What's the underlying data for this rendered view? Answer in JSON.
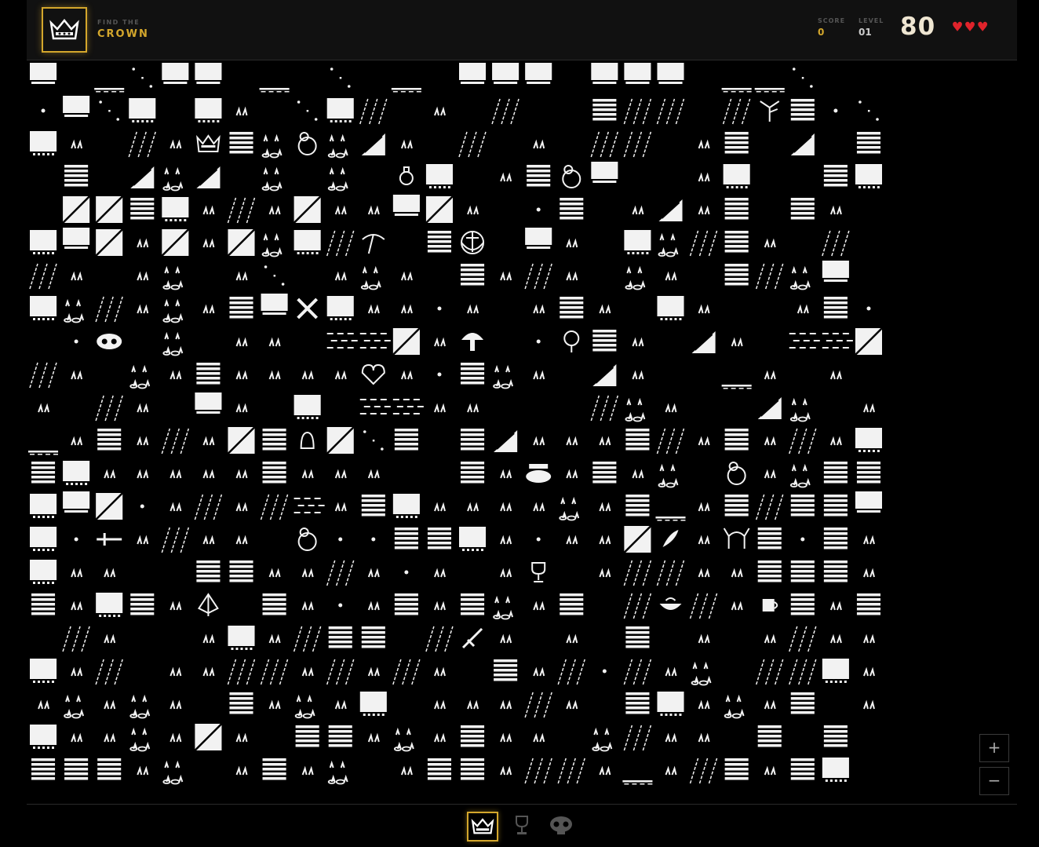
{
  "header": {
    "subtitle": "FIND THE",
    "title": "CROWN",
    "logo_icon": "crown-icon",
    "score_label": "SCORE",
    "score_value": "0",
    "level_label": "LEVEL",
    "level_value": "01",
    "counter": "80",
    "hearts": 3,
    "colors": {
      "accent": "#d4a72c",
      "heart": "#e0232b",
      "counter": "#efe6d2"
    }
  },
  "board": {
    "cols": 26,
    "rows": 22,
    "tiles": [
      "F.wbFF.w.b.w.FFF.FFF.wwb..F..",
      "cFbB.Bp.bBG.p.G..SGG.G.Ssb",
      "Bp.Gp.SgGgRp.G.p.GG.pS.R.S",
      ".S.RgR.g.g.oB.pSpF..pB..SB",
      ".WWSBpGpWppFWp.VS.pRpS.Sp.",
      "BFWpWpWgBGW.SR.Fp.BgGSp.G.",
      "Gp.pg.pb.pgp.SpGp.gp.SGgF.",
      "BgGpgpSF.Bppsp.pSp.Bp..pSP",
      ".kp.g.pp.DDWpB.ogSp.Rp.DDW",
      "Gp.gpSppppppsSgp.Rp..wp.p.",
      "p.Gp.Fp.B.DDpp...Ggp..Rg.p",
      "wpSpGpWSgWbS.SRpppSGpSpGpB",
      "SBpppppSppp..SpppSpg.SpgSS",
      "BFWlpGpGDpSBppppgpSwpSGSSF",
      "BlRpGpp.ghhSSBphppWgp.SfSp",
      "Bpp..SSppGpmp.p..pGGppSSSp",
      "SpBSp..SpspSpSgpS.GpGp.SpS",
      ".Gp..pBpGSS.GSp.p.S.p.pGpp",
      "BpG.ppGGpGpGp.SpGhGpg.GGBp",
      "pgpgp.SpgpB.pppGp.SBpgpS.p",
      "BppgpWp.SSpgpSpp.gGpp.S.S.",
      "SSSpg.pSpg.pSSpGGpwpGSpSB."
    ],
    "items": [
      {
        "name": "crown-icon",
        "col": 5,
        "row": 2
      },
      {
        "name": "ring-icon",
        "col": 8,
        "row": 2
      },
      {
        "name": "ring-icon",
        "col": 16,
        "row": 3
      },
      {
        "name": "potion-icon",
        "col": 11,
        "row": 3
      },
      {
        "name": "anchor-icon",
        "col": 13,
        "row": 5
      },
      {
        "name": "pickaxe-icon",
        "col": 10,
        "row": 5
      },
      {
        "name": "crossbones-icon",
        "col": 8,
        "row": 7
      },
      {
        "name": "skull-icon",
        "col": 2,
        "row": 8
      },
      {
        "name": "mushroom-icon",
        "col": 13,
        "row": 8
      },
      {
        "name": "heart-icon",
        "col": 10,
        "row": 9
      },
      {
        "name": "shield-icon",
        "col": 16,
        "row": 8
      },
      {
        "name": "bell-icon",
        "col": 8,
        "row": 11
      },
      {
        "name": "cauldron-icon",
        "col": 15,
        "row": 12
      },
      {
        "name": "ring-icon",
        "col": 21,
        "row": 12
      },
      {
        "name": "sword-icon",
        "col": 2,
        "row": 14
      },
      {
        "name": "ring-icon",
        "col": 8,
        "row": 14
      },
      {
        "name": "feather-icon",
        "col": 19,
        "row": 14
      },
      {
        "name": "horned-helmet-icon",
        "col": 21,
        "row": 14
      },
      {
        "name": "chalice-icon",
        "col": 15,
        "row": 15
      },
      {
        "name": "leaf-icon",
        "col": 5,
        "row": 16
      },
      {
        "name": "bowl-icon",
        "col": 19,
        "row": 16
      },
      {
        "name": "mug-icon",
        "col": 22,
        "row": 16
      },
      {
        "name": "dagger-icon",
        "col": 13,
        "row": 17
      },
      {
        "name": "tree-icon",
        "col": 22,
        "row": 1
      }
    ]
  },
  "zoom": {
    "in_label": "+",
    "out_label": "−"
  },
  "inventory": [
    {
      "name": "crown-slot",
      "icon": "crown-icon",
      "active": true
    },
    {
      "name": "chalice-slot",
      "icon": "chalice-icon",
      "active": false
    },
    {
      "name": "skull-slot",
      "icon": "skull-icon",
      "active": false
    }
  ]
}
